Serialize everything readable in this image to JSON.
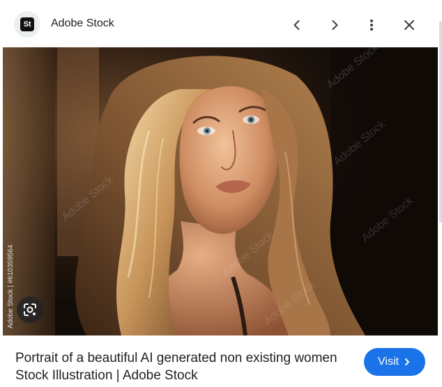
{
  "header": {
    "logo_text": "St",
    "site_name": "Adobe Stock",
    "icons": [
      "chevron-left-icon",
      "chevron-right-icon",
      "more-vert-icon",
      "close-icon"
    ]
  },
  "image": {
    "watermark": "Adobe Stock",
    "stock_id": "Adobe Stock | #610359564",
    "lens_icon": "lens-search-icon"
  },
  "footer": {
    "caption": "Portrait of a beautiful AI generated non existing women Stock Illustration | Adobe Stock",
    "visit_label": "Visit"
  },
  "colors": {
    "accent": "#1a73e8",
    "text": "#202124",
    "icon": "#5f6368"
  }
}
